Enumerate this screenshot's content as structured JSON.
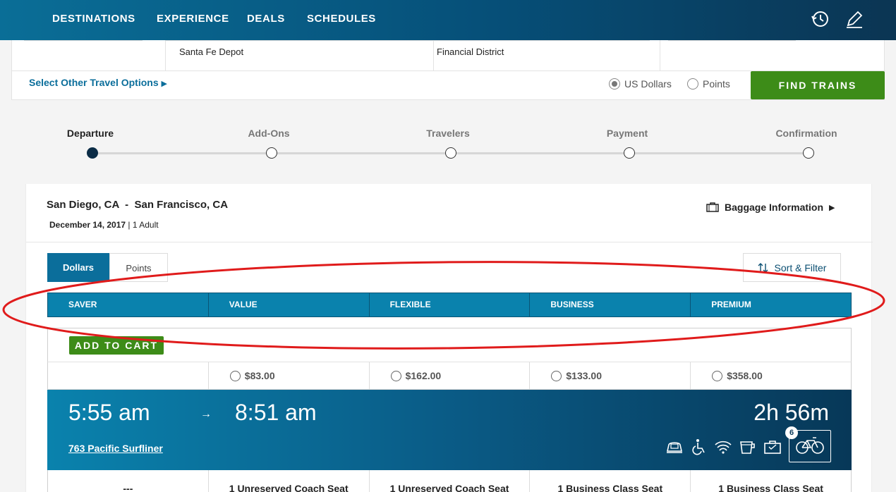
{
  "nav": {
    "items": [
      "DESTINATIONS",
      "EXPERIENCE",
      "DEALS",
      "SCHEDULES"
    ],
    "icons": [
      "history-icon",
      "edit-icon"
    ]
  },
  "booking": {
    "from_station": "Santa Fe Depot",
    "to_station": "Financial District",
    "other_options": "Select Other Travel Options",
    "currency_options": [
      {
        "label": "US Dollars",
        "selected": true
      },
      {
        "label": "Points",
        "selected": false
      }
    ],
    "find_button": "FIND TRAINS"
  },
  "stepper": {
    "steps": [
      "Departure",
      "Add-Ons",
      "Travelers",
      "Payment",
      "Confirmation"
    ],
    "active_index": 0
  },
  "trip": {
    "route_from": "San Diego, CA",
    "route_sep": "-",
    "route_to": "San Francisco, CA",
    "date": "December 14, 2017",
    "date_sep": "|",
    "travelers": "1 Adult",
    "baggage_label": "Baggage Information"
  },
  "results": {
    "tabs": [
      "Dollars",
      "Points"
    ],
    "sort_label": "Sort & Filter",
    "fare_classes": [
      "SAVER",
      "VALUE",
      "FLEXIBLE",
      "BUSINESS",
      "PREMIUM"
    ],
    "add_to_cart": "ADD TO CART",
    "prices": [
      "",
      "$83.00",
      "$162.00",
      "$133.00",
      "$358.00"
    ]
  },
  "train": {
    "depart": "5:55 am",
    "arrow": "→",
    "arrive": "8:51 am",
    "duration": "2h 56m",
    "name": "763 Pacific Surfliner",
    "bike_count": "6",
    "seats": [
      "---",
      "1 Unreserved Coach Seat",
      "1 Unreserved Coach Seat",
      "1 Business Class Seat",
      "1 Business Class Seat"
    ]
  },
  "colors": {
    "brand_blue": "#0a82ad",
    "nav_dark": "#064f78",
    "action_green": "#3d8c18",
    "annotation_red": "#e01b1b"
  }
}
